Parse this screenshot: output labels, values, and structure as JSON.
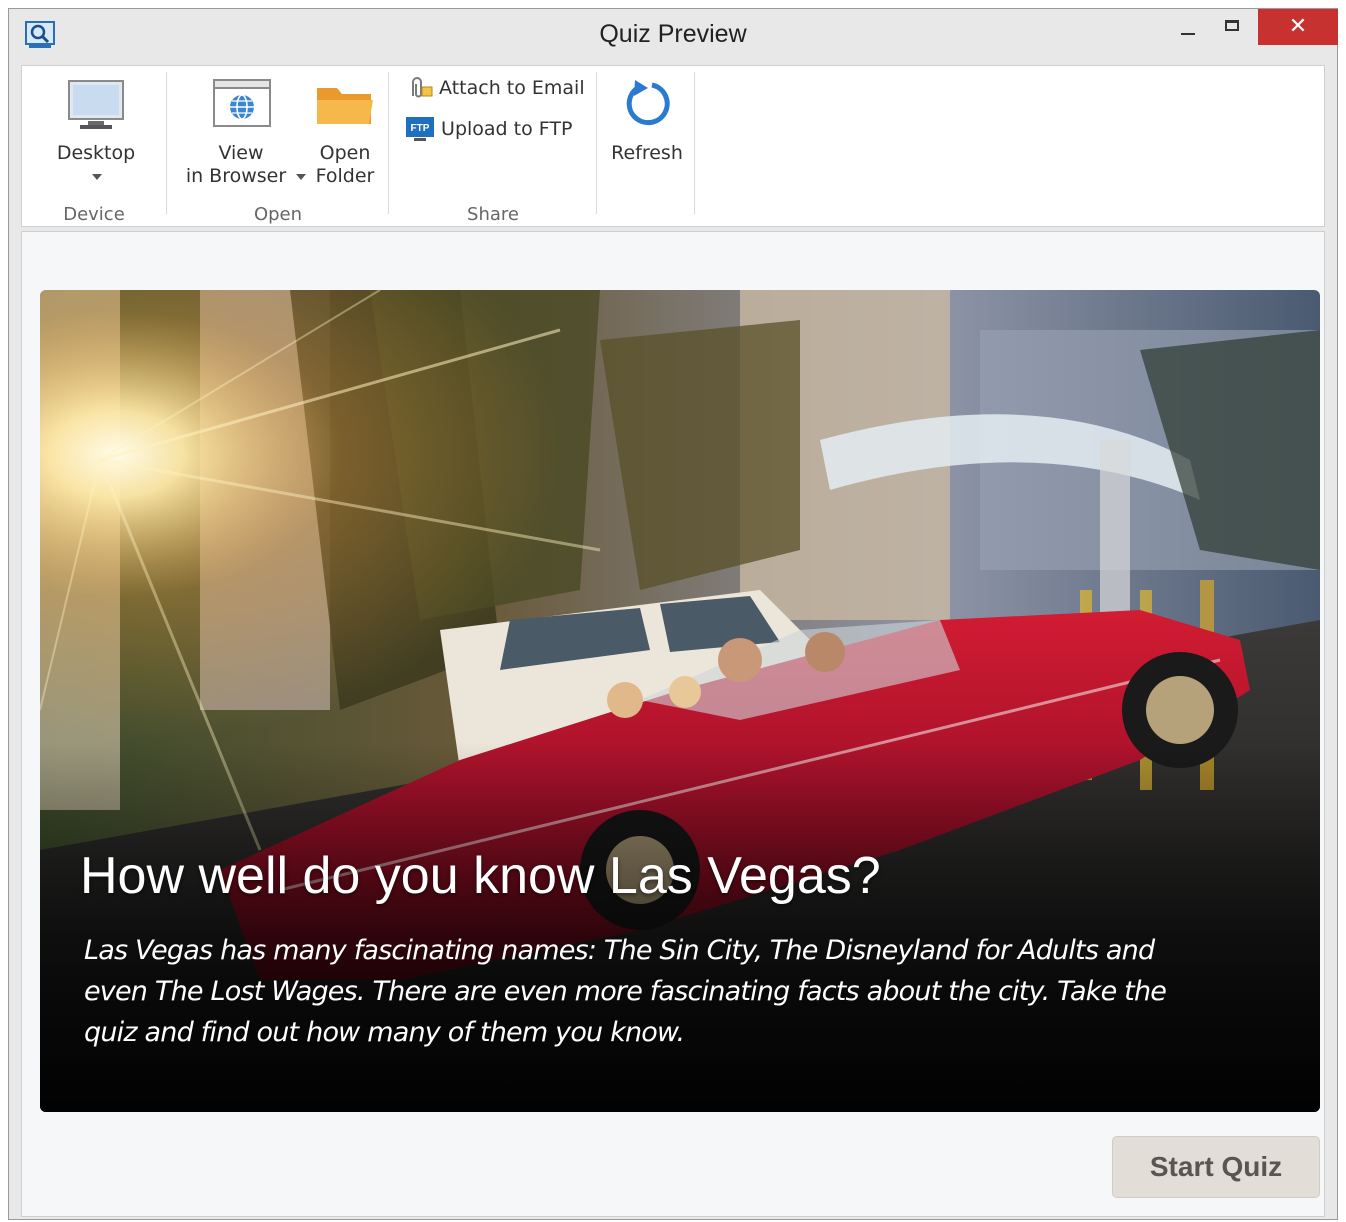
{
  "window": {
    "title": "Quiz Preview",
    "close_glyph": "✕"
  },
  "ribbon": {
    "device": {
      "label": "Device",
      "desktop_label": "Desktop"
    },
    "open": {
      "label": "Open",
      "view_line1": "View",
      "view_line2": "in Browser",
      "folder_line1": "Open",
      "folder_line2": "Folder"
    },
    "share": {
      "label": "Share",
      "email_label": "Attach to Email",
      "ftp_label": "Upload to FTP",
      "ftp_badge": "FTP"
    },
    "refresh": {
      "label": "Refresh"
    }
  },
  "quiz": {
    "title": "How well do you know Las Vegas?",
    "description": "Las Vegas has many fascinating names: The Sin City, The Disneyland for Adults and even The Lost Wages. There are even more fascinating facts about the city. Take the quiz and find out how many of them you know.",
    "start_label": "Start Quiz"
  },
  "colors": {
    "close": "#c7312f",
    "car": "#b8122a",
    "accent_blue": "#1e6fc0",
    "folder": "#f2a536"
  },
  "icons": [
    "app-preview-icon",
    "desktop-monitor-icon",
    "browser-globe-icon",
    "folder-icon",
    "paperclip-icon",
    "ftp-icon",
    "refresh-icon",
    "chevron-down-icon"
  ]
}
